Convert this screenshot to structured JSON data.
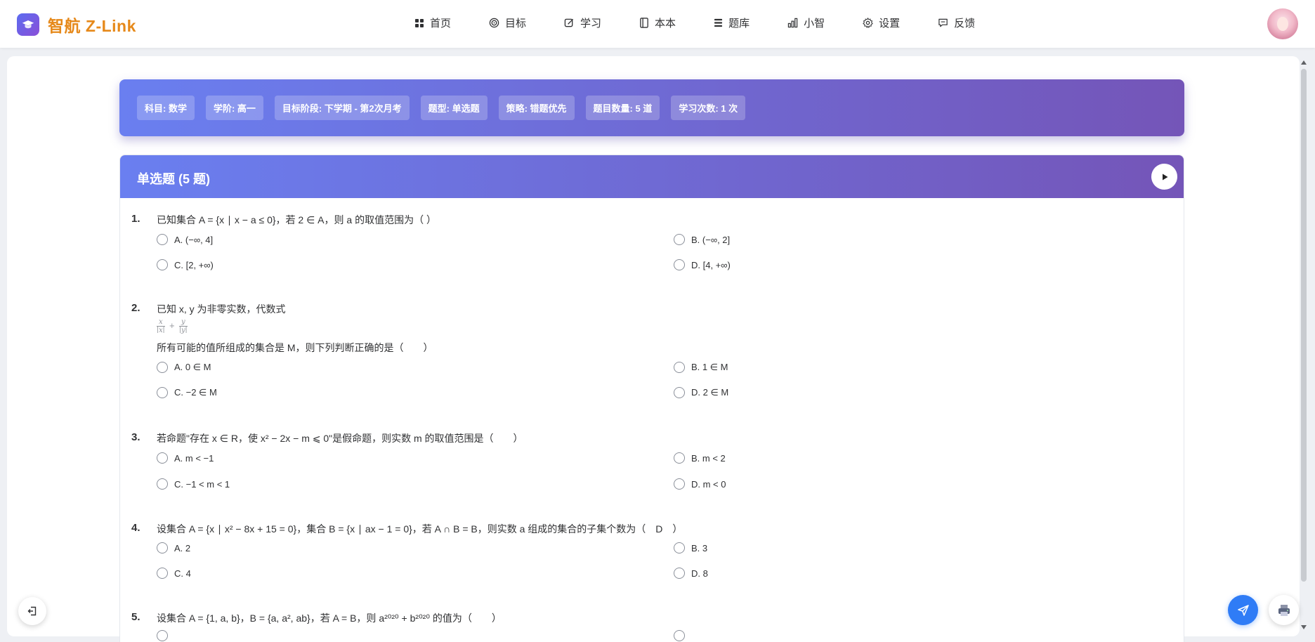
{
  "app": {
    "name": "智航 Z-Link"
  },
  "nav": {
    "items": [
      {
        "label": "首页",
        "icon": "grid-icon"
      },
      {
        "label": "目标",
        "icon": "target-icon"
      },
      {
        "label": "学习",
        "icon": "edit-icon"
      },
      {
        "label": "本本",
        "icon": "notebook-icon"
      },
      {
        "label": "题库",
        "icon": "list-icon"
      },
      {
        "label": "小智",
        "icon": "bar-chart-icon"
      },
      {
        "label": "设置",
        "icon": "gear-icon"
      },
      {
        "label": "反馈",
        "icon": "message-icon"
      }
    ]
  },
  "info_chips": [
    "科目: 数学",
    "学阶: 高一",
    "目标阶段: 下学期 - 第2次月考",
    "题型: 单选题",
    "策略: 错题优先",
    "题目数量: 5 道",
    "学习次数: 1 次"
  ],
  "section": {
    "title": "单选题 (5 题)"
  },
  "questions": [
    {
      "num": "1.",
      "text": "已知集合 A = {x ∣ x − a ≤ 0}，若 2 ∈ A，则 a 的取值范围为（ ）",
      "options": [
        "A. (−∞, 4]",
        "B. (−∞, 2]",
        "C. [2, +∞)",
        "D. [4, +∞)"
      ]
    },
    {
      "num": "2.",
      "text": "已知 x, y 为非零实数，代数式",
      "formula": [
        "x",
        "∣x∣",
        "+",
        "y",
        "∣y∣"
      ],
      "text2": "所有可能的值所组成的集合是 M，则下列判断正确的是（　　）",
      "options": [
        "A. 0 ∈ M",
        "B. 1 ∈ M",
        "C. −2 ∈ M",
        "D. 2 ∈ M"
      ]
    },
    {
      "num": "3.",
      "text": "若命题\"存在 x ∈ R，使 x² − 2x − m ⩽ 0\"是假命题，则实数 m 的取值范围是（　　）",
      "options": [
        "A. m < −1",
        "B. m < 2",
        "C. −1 < m < 1",
        "D. m < 0"
      ]
    },
    {
      "num": "4.",
      "text": "设集合 A = {x ∣ x² − 8x + 15 = 0}，集合 B = {x ∣ ax − 1 = 0}，若 A ∩ B = B，则实数 a 组成的集合的子集个数为（　D　）",
      "options": [
        "A. 2",
        "B. 3",
        "C. 4",
        "D. 8"
      ]
    },
    {
      "num": "5.",
      "text": "设集合 A = {1, a, b}，B = {a, a², ab}，若 A = B，则 a²⁰²⁰ + b²⁰²⁰ 的值为（　　）"
    }
  ],
  "colors": {
    "brand": "#e6891a",
    "gradient_start": "#6a7ff0",
    "gradient_end": "#7455b8",
    "send": "#2f7cf6"
  }
}
